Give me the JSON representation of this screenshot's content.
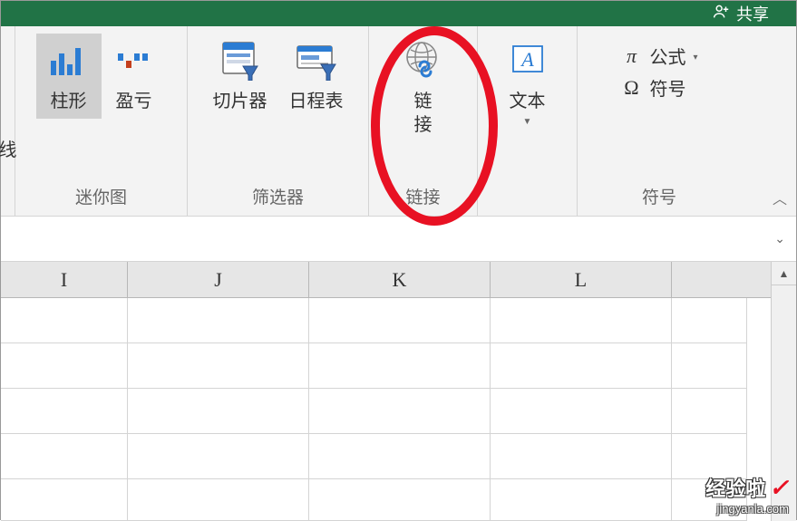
{
  "titlebar": {
    "share_label": "共享"
  },
  "ribbon": {
    "sparklines": {
      "column_label": "柱形",
      "winloss_label": "盈亏",
      "group_label": "迷你图",
      "partial_prev": "线"
    },
    "filters": {
      "slicer_label": "切片器",
      "timeline_label": "日程表",
      "group_label": "筛选器"
    },
    "links": {
      "link_label_line1": "链",
      "link_label_line2": "接",
      "group_label": "链接"
    },
    "text": {
      "text_label": "文本"
    },
    "symbols": {
      "formula_label": "公式",
      "symbol_label": "符号",
      "group_label": "符号"
    }
  },
  "columns": [
    "I",
    "J",
    "K",
    "L"
  ],
  "watermark": {
    "top": "经验啦",
    "bottom": "jingyanla.com"
  }
}
